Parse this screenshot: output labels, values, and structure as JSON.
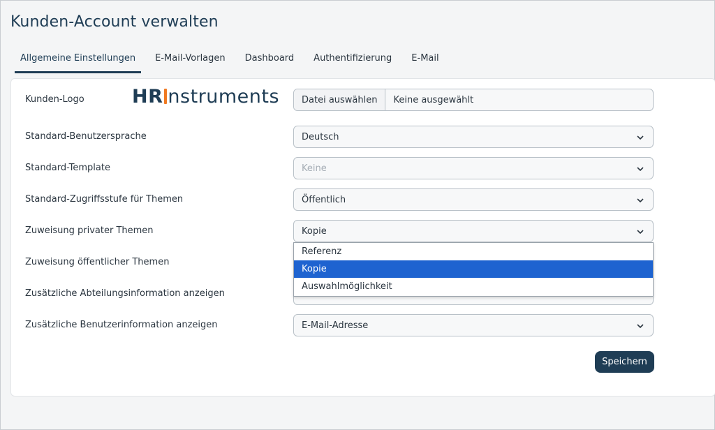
{
  "page": {
    "title": "Kunden-Account verwalten"
  },
  "tabs": [
    {
      "label": "Allgemeine Einstellungen",
      "active": true
    },
    {
      "label": "E-Mail-Vorlagen",
      "active": false
    },
    {
      "label": "Dashboard",
      "active": false
    },
    {
      "label": "Authentifizierung",
      "active": false
    },
    {
      "label": "E-Mail",
      "active": false
    }
  ],
  "form": {
    "logo": {
      "label": "Kunden-Logo",
      "logo_text_bold": "HR",
      "logo_text_rest": "nstruments",
      "file_button": "Datei auswählen",
      "file_status": "Keine ausgewählt"
    },
    "language": {
      "label": "Standard-Benutzersprache",
      "value": "Deutsch"
    },
    "template": {
      "label": "Standard-Template",
      "value": "Keine"
    },
    "access_level": {
      "label": "Standard-Zugriffsstufe für Themen",
      "value": "Öffentlich"
    },
    "private_assignment": {
      "label": "Zuweisung privater Themen",
      "value": "Kopie",
      "options": [
        "Referenz",
        "Kopie",
        "Auswahlmöglichkeit"
      ],
      "selected_index": 1
    },
    "public_assignment": {
      "label": "Zuweisung öffentlicher Themen"
    },
    "department_info": {
      "label": "Zusätzliche Abteilungsinformation anzeigen"
    },
    "user_info": {
      "label": "Zusätzliche Benutzerinformation anzeigen",
      "value": "E-Mail-Adresse"
    },
    "save_label": "Speichern"
  },
  "colors": {
    "primary": "#1f3d55",
    "logo_accent": "#f07a22",
    "selection": "#1e63d0"
  },
  "icons": {
    "select_arrow": "chevron-down-icon"
  }
}
